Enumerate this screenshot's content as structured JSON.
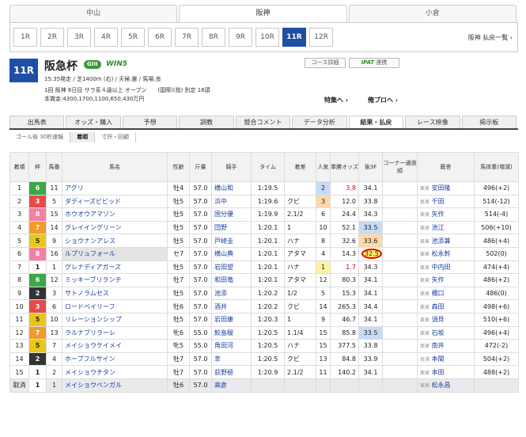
{
  "venues": [
    "中山",
    "阪神",
    "小倉"
  ],
  "active_venue": 1,
  "race_buttons": [
    "1R",
    "2R",
    "3R",
    "4R",
    "5R",
    "6R",
    "7R",
    "8R",
    "9R",
    "10R",
    "11R",
    "12R"
  ],
  "active_race": 10,
  "race_list_label": "阪神 払戻一覧 ›",
  "race": {
    "number": "11R",
    "name": "阪急杯",
    "grade": "GIII",
    "win5": "WIN5",
    "info1": "15:35発走 / 芝1400m (右) / 天候:曇 / 馬場:良",
    "info2": "1回 阪神 6日目 サラ系４歳以上 オープン　　(国際)(指) 別定 16頭",
    "info3": "本賞金:4300,1700,1100,650,430万円"
  },
  "buttons": {
    "course": "コース詳細",
    "ipat": "IPAT",
    "ipat_suffix": "連携",
    "feature": "特集へ ›",
    "ore": "俺プロへ ›"
  },
  "tabs": [
    "出馬表",
    "オッズ・購入",
    "予想",
    "調教",
    "競合コメント",
    "データ分析",
    "結果・払戻",
    "レース映像",
    "掲示板"
  ],
  "active_tab": 6,
  "subtabs": [
    "ゴール後 30秒速報",
    "着順",
    "寸評・回顧"
  ],
  "active_subtab": 1,
  "headers": [
    "着順",
    "枠",
    "馬番",
    "馬名",
    "性齢",
    "斤量",
    "騎手",
    "タイム",
    "着差",
    "人気",
    "単勝オッズ",
    "後3F",
    "コーナー通過順",
    "厩舎",
    "馬体重(増減)"
  ],
  "rows": [
    {
      "pos": "1",
      "waku": "6",
      "num": "11",
      "name": "アグリ",
      "sa": "牡4",
      "kin": "57.0",
      "jockey": "横山和",
      "time": "1:19.5",
      "diff": "",
      "pop": "2",
      "odds": "3.8",
      "f3": "34.1",
      "area": "栗東",
      "trainer": "安田隆",
      "weight": "496(+2)"
    },
    {
      "pos": "2",
      "waku": "3",
      "num": "5",
      "name": "ダディーズビビッド",
      "sa": "牡5",
      "kin": "57.0",
      "jockey": "浜中",
      "time": "1:19.6",
      "diff": "クビ",
      "pop": "3",
      "odds": "12.0",
      "f3": "33.8",
      "area": "栗東",
      "trainer": "千田",
      "weight": "514(-12)"
    },
    {
      "pos": "3",
      "waku": "8",
      "num": "15",
      "name": "ホウオウアマゾン",
      "sa": "牡5",
      "kin": "57.0",
      "jockey": "国分優",
      "time": "1:19.9",
      "diff": "2.1/2",
      "pop": "6",
      "odds": "24.4",
      "f3": "34.3",
      "area": "栗東",
      "trainer": "矢作",
      "weight": "514(-4)"
    },
    {
      "pos": "4",
      "waku": "7",
      "num": "14",
      "name": "グレイイングリーン",
      "sa": "牡5",
      "kin": "57.0",
      "jockey": "団野",
      "time": "1:20.1",
      "diff": "1",
      "pop": "10",
      "odds": "52.1",
      "f3": "33.5",
      "area": "栗東",
      "trainer": "池江",
      "weight": "506(+10)"
    },
    {
      "pos": "5",
      "waku": "5",
      "num": "9",
      "name": "ショウナンアレス",
      "sa": "牡5",
      "kin": "57.0",
      "jockey": "戸崎圭",
      "time": "1:20.1",
      "diff": "ハナ",
      "pop": "8",
      "odds": "32.6",
      "f3": "33.6",
      "area": "栗東",
      "trainer": "池添兼",
      "weight": "486(+4)"
    },
    {
      "pos": "6",
      "waku": "8",
      "num": "16",
      "name": "ルプリュフォール",
      "sa": "セ7",
      "kin": "57.0",
      "jockey": "横山典",
      "time": "1:20.1",
      "diff": "アタマ",
      "pop": "4",
      "odds": "14.3",
      "f3": "32.5",
      "area": "栗東",
      "trainer": "松永幹",
      "weight": "502(0)"
    },
    {
      "pos": "7",
      "waku": "1",
      "num": "1",
      "name": "グレナディアガーズ",
      "sa": "牡5",
      "kin": "57.0",
      "jockey": "岩田望",
      "time": "1:20.1",
      "diff": "ハナ",
      "pop": "1",
      "odds": "1.7",
      "f3": "34.3",
      "area": "栗東",
      "trainer": "中内田",
      "weight": "474(+4)"
    },
    {
      "pos": "8",
      "waku": "6",
      "num": "12",
      "name": "ミッキーブリランテ",
      "sa": "牡7",
      "kin": "57.0",
      "jockey": "和田竜",
      "time": "1:20.1",
      "diff": "アタマ",
      "pop": "12",
      "odds": "80.3",
      "f3": "34.1",
      "area": "栗東",
      "trainer": "矢作",
      "weight": "486(+2)"
    },
    {
      "pos": "9",
      "waku": "2",
      "num": "3",
      "name": "サトノラムセス",
      "sa": "牡5",
      "kin": "57.0",
      "jockey": "池添",
      "time": "1:20.2",
      "diff": "1/2",
      "pop": "5",
      "odds": "15.3",
      "f3": "34.1",
      "area": "栗東",
      "trainer": "橋口",
      "weight": "486(0)"
    },
    {
      "pos": "10",
      "waku": "3",
      "num": "6",
      "name": "ロードベイリーフ",
      "sa": "牡6",
      "kin": "57.0",
      "jockey": "酒井",
      "time": "1:20.2",
      "diff": "クビ",
      "pop": "14",
      "odds": "265.3",
      "f3": "34.4",
      "area": "栗東",
      "trainer": "森田",
      "weight": "498(+6)"
    },
    {
      "pos": "11",
      "waku": "5",
      "num": "10",
      "name": "リレーションシップ",
      "sa": "牡5",
      "kin": "57.0",
      "jockey": "岩田康",
      "time": "1:20.3",
      "diff": "1",
      "pop": "9",
      "odds": "46.7",
      "f3": "34.1",
      "area": "栗東",
      "trainer": "須貝",
      "weight": "510(+6)"
    },
    {
      "pos": "12",
      "waku": "7",
      "num": "13",
      "name": "ラルナブリラーレ",
      "sa": "牝6",
      "kin": "55.0",
      "jockey": "鮫島駿",
      "time": "1:20.5",
      "diff": "1.1/4",
      "pop": "15",
      "odds": "85.8",
      "f3": "33.5",
      "area": "栗東",
      "trainer": "石坂",
      "weight": "496(+4)"
    },
    {
      "pos": "13",
      "waku": "5",
      "num": "7",
      "name": "メイショウケイメイ",
      "sa": "牝5",
      "kin": "55.0",
      "jockey": "角田河",
      "time": "1:20.5",
      "diff": "ハナ",
      "pop": "15",
      "odds": "377.5",
      "f3": "33.8",
      "area": "栗東",
      "trainer": "南井",
      "weight": "472(-2)"
    },
    {
      "pos": "14",
      "waku": "2",
      "num": "4",
      "name": "ホープフルサイン",
      "sa": "牡7",
      "kin": "57.0",
      "jockey": "幸",
      "time": "1:20.5",
      "diff": "クビ",
      "pop": "13",
      "odds": "84.8",
      "f3": "33.9",
      "area": "美浦",
      "trainer": "本間",
      "weight": "504(+2)"
    },
    {
      "pos": "15",
      "waku": "1",
      "num": "2",
      "name": "メイショウチタン",
      "sa": "牡7",
      "kin": "57.0",
      "jockey": "荻野極",
      "time": "1:20.9",
      "diff": "2.1/2",
      "pop": "11",
      "odds": "140.2",
      "f3": "34.1",
      "area": "栗東",
      "trainer": "本田",
      "weight": "488(+2)"
    },
    {
      "pos": "取消",
      "waku": "1",
      "num": "1",
      "name": "メイショウベンガル",
      "sa": "牡6",
      "kin": "57.0",
      "jockey": "高倉",
      "time": "",
      "diff": "",
      "pop": "",
      "odds": "",
      "f3": "",
      "area": "栗東",
      "trainer": "松永昌",
      "weight": ""
    }
  ],
  "waku_colors": {
    "1": "#ffffff",
    "2": "#333333",
    "3": "#e54b4b",
    "4": "#3a6fd8",
    "5": "#e8c817",
    "6": "#3aa845",
    "7": "#f29a2e",
    "8": "#f47fa5"
  }
}
